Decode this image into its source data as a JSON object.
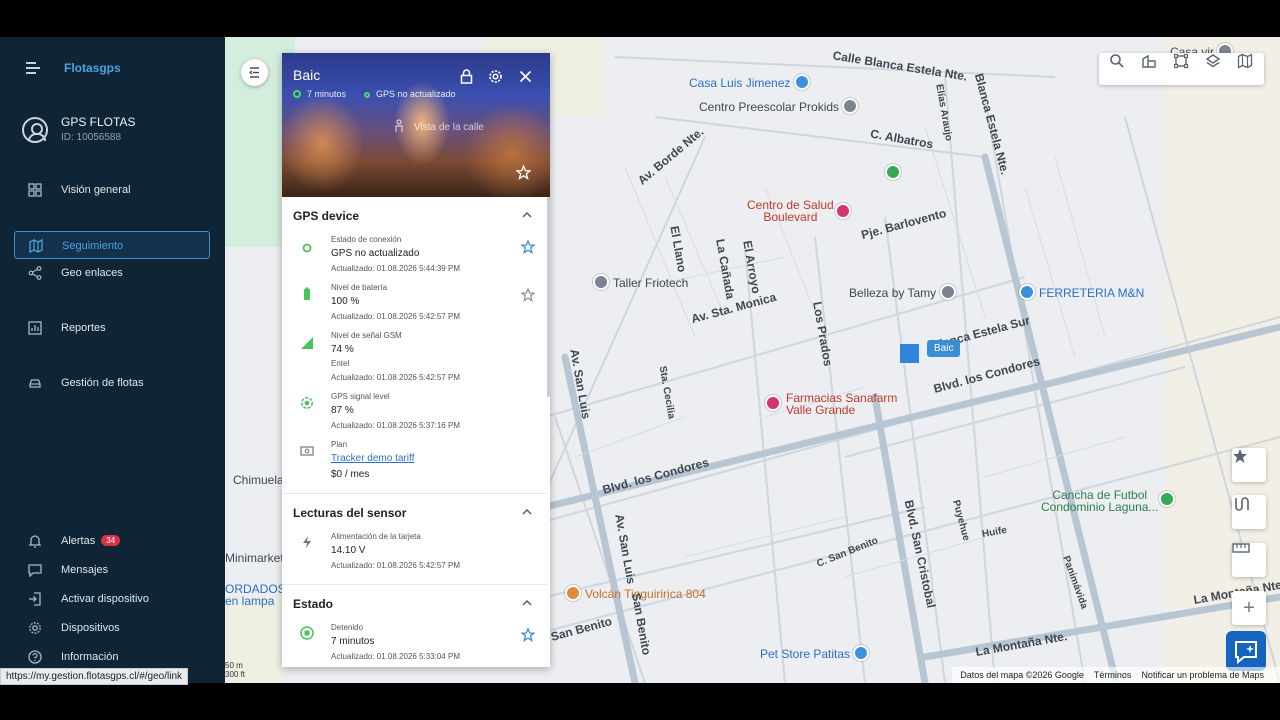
{
  "app": {
    "logo": "Flotasgps"
  },
  "user": {
    "name": "GPS FLOTAS",
    "id": "ID: 10056588"
  },
  "nav": {
    "overview": "Visión general",
    "tracking": "Seguimiento",
    "geolinks": "Geo enlaces",
    "reports": "Reportes",
    "fleet": "Gestión de flotas",
    "alerts": "Alertas",
    "alerts_count": "34",
    "messages": "Mensajes",
    "activate": "Activar dispositivo",
    "devices": "Dispositivos",
    "info": "Información"
  },
  "panel": {
    "vehicle_name": "Baic",
    "time_status": "7 minutos",
    "gps_status": "GPS no actualizado",
    "street_view": "Vista de la calle",
    "section_gps": "GPS device",
    "section_sensor": "Lecturas del sensor",
    "section_state": "Estado",
    "rows": {
      "connection": {
        "label": "Estado de conexión",
        "value": "GPS no actualizado",
        "updated": "Actualizado: 01.08.2026 5:44:39 PM"
      },
      "battery": {
        "label": "Nivel de batería",
        "value": "100 %",
        "updated": "Actualizado: 01.08.2026 5:42:57 PM"
      },
      "gsm": {
        "label": "Nivel de señal GSM",
        "value": "74 %",
        "operator": "Entel",
        "updated": "Actualizado: 01.08.2026 5:42:57 PM"
      },
      "gps_signal": {
        "label": "GPS signal level",
        "value": "87 %",
        "updated": "Actualizado: 01.08.2026 5:37:16 PM"
      },
      "plan": {
        "label": "Plan",
        "link": "Tracker demo tariff",
        "value": "$0 / mes"
      },
      "power": {
        "label": "Alimentación de la tarjeta",
        "value": "14.10 V",
        "updated": "Actualizado: 01.08.2026 5:42:57 PM"
      },
      "stopped": {
        "label": "Detenido",
        "value": "7 minutos",
        "updated": "Actualizado: 01.08.2026 5:33:04 PM"
      }
    }
  },
  "map": {
    "vehicle_label": "Baic",
    "pois": {
      "casa_luis": "Casa Luis Jimenez",
      "prokids": "Centro Preescolar Prokids",
      "salud": "Centro de Salud\nBoulevard",
      "taller": "Taller Friotech",
      "belleza": "Belleza by Tamy",
      "ferreteria": "FERRETERIA M&N",
      "farmacia": "Farmacias Sanafarm\nValle Grande",
      "cancha": "Cancha de Futbol\nCondominio Laguna...",
      "volcan": "Volcán Tinguiririca 804",
      "petstore": "Pet Store Patitas",
      "casa_vir": "Casa vir",
      "chimuela": "Chimuela",
      "minimarket": "Minimarket",
      "ordados": "ORDADOS\nen lampa"
    },
    "roads": {
      "blanca_estela_nte": "Calle Blanca Estela Nte.",
      "blanca_estela_nte2": "Blanca Estela Nte.",
      "elias_araujo": "Elías Araujo",
      "albatros": "C. Albatros",
      "borde_nte": "Av. Borde Nte.",
      "barlovento": "Pje. Barlovento",
      "el_llano": "El Llano",
      "la_canada": "La Cañada",
      "el_arroyo": "El Arroyo",
      "los_prados": "Los Prados",
      "sta_monica": "Av. Sta. Monica",
      "blanca_estela_sur": "Blanca Estela Sur",
      "los_condores": "Blvd. los Condores",
      "san_luis": "Av. San Luis",
      "sta_cecilia": "Sta. Cecilia",
      "san_benito": "San Benito",
      "c_san_benito": "C. San Benito",
      "san_cristobal": "Blvd. San Cristobal",
      "puyehue": "Puyehue",
      "huife": "Huife",
      "panimavida": "Panimávida",
      "montana_nte": "La Montaña Nte."
    },
    "scale_m": "50 m",
    "scale_ft": "300 ft",
    "footer_data": "Datos del mapa ©2026 Google",
    "footer_terms": "Términos",
    "footer_report": "Notificar un problema de Maps"
  },
  "statusbar": {
    "url": "https://my.gestion.flotasgps.cl/#/geo/link"
  },
  "colors": {
    "sidebar": "#0f2535",
    "accent": "#3a8fd4",
    "green": "#4cd964",
    "badge": "#d6334a"
  }
}
